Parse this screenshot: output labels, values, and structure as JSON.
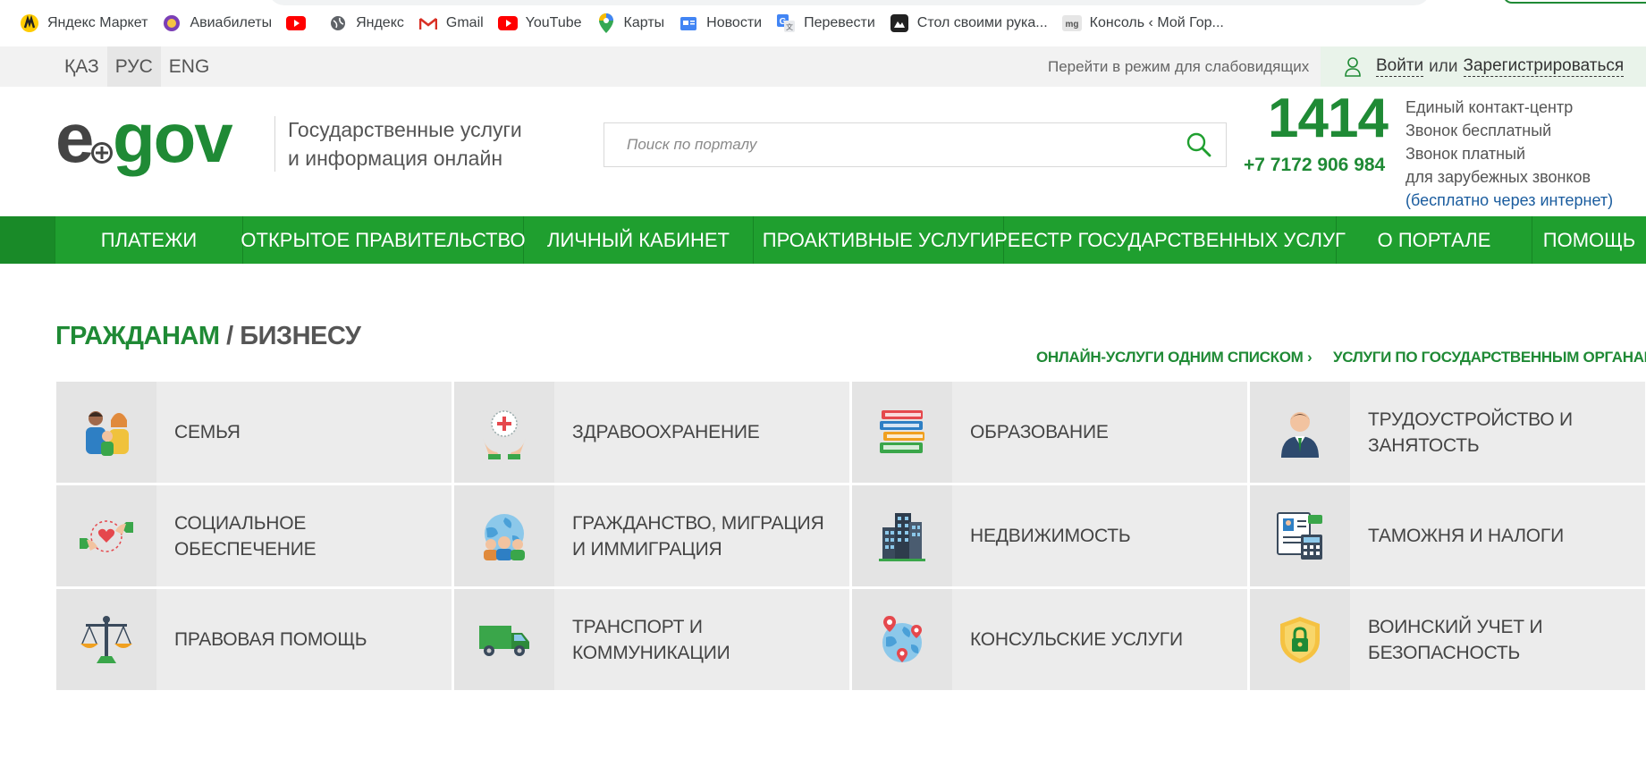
{
  "bookmarks": [
    {
      "label": "Яндекс Маркет",
      "icon": "yandex-market-icon"
    },
    {
      "label": "Авиабилеты",
      "icon": "aviatickets-icon"
    },
    {
      "label": "",
      "icon": "youtube-icon"
    },
    {
      "label": "Яндекс",
      "icon": "globe-icon"
    },
    {
      "label": "Gmail",
      "icon": "gmail-icon"
    },
    {
      "label": "YouTube",
      "icon": "youtube-icon"
    },
    {
      "label": "Карты",
      "icon": "maps-pin-icon"
    },
    {
      "label": "Новости",
      "icon": "news-icon"
    },
    {
      "label": "Перевести",
      "icon": "translate-icon"
    },
    {
      "label": "Стол своими рука...",
      "icon": "table-icon"
    },
    {
      "label": "Консоль ‹ Мой Гор...",
      "icon": "mg-icon"
    }
  ],
  "utility": {
    "languages": [
      "ҚАЗ",
      "РУС",
      "ENG"
    ],
    "active_language": "РУС",
    "vision_mode": "Перейти в режим для слабовидящих",
    "login": "Войти",
    "or": "или",
    "register": "Зарегистрироваться"
  },
  "header": {
    "logo_text": "egov",
    "tagline_line1": "Государственные услуги",
    "tagline_line2": "и информация онлайн",
    "search_placeholder": "Поиск по порталу",
    "phone_short": "1414",
    "phone_full": "+7 7172 906 984",
    "contact_line1": "Единый контакт-центр",
    "contact_line2": "Звонок бесплатный",
    "contact_line3": "Звонок платный",
    "contact_line4": "для зарубежных звонков",
    "contact_line5": "(бесплатно через интернет)"
  },
  "nav": [
    "ПЛАТЕЖИ",
    "ОТКРЫТОЕ ПРАВИТЕЛЬСТВО",
    "ЛИЧНЫЙ КАБИНЕТ",
    "ПРОАКТИВНЫЕ УСЛУГИ",
    "РЕЕСТР ГОСУДАРСТВЕННЫХ УСЛУГ",
    "О ПОРТАЛЕ",
    "ПОМОЩЬ"
  ],
  "main": {
    "title_citizens": "ГРАЖДАНАМ",
    "title_sep": " / ",
    "title_business": "БИЗНЕСУ",
    "link_online": "ОНЛАЙН-УСЛУГИ ОДНИМ СПИСКОМ ›",
    "link_by_agency": "УСЛУГИ ПО ГОСУДАРСТВЕННЫМ ОРГАНАМ ›",
    "categories": [
      {
        "label": "СЕМЬЯ",
        "icon": "family-icon"
      },
      {
        "label": "ЗДРАВООХРАНЕНИЕ",
        "icon": "healthcare-icon"
      },
      {
        "label": "ОБРАЗОВАНИЕ",
        "icon": "books-icon"
      },
      {
        "label": "ТРУДОУСТРОЙСТВО И ЗАНЯТОСТЬ",
        "icon": "employee-icon"
      },
      {
        "label": "СОЦИАЛЬНОЕ ОБЕСПЕЧЕНИЕ",
        "icon": "social-care-icon"
      },
      {
        "label": "ГРАЖДАНСТВО, МИГРАЦИЯ И ИММИГРАЦИЯ",
        "icon": "globe-people-icon"
      },
      {
        "label": "НЕДВИЖИМОСТЬ",
        "icon": "buildings-icon"
      },
      {
        "label": "ТАМОЖНЯ И НАЛОГИ",
        "icon": "tax-calculator-icon"
      },
      {
        "label": "ПРАВОВАЯ ПОМОЩЬ",
        "icon": "scales-icon"
      },
      {
        "label": "ТРАНСПОРТ И КОММУНИКАЦИИ",
        "icon": "truck-icon"
      },
      {
        "label": "КОНСУЛЬСКИЕ УСЛУГИ",
        "icon": "globe-pins-icon"
      },
      {
        "label": "ВОИНСКИЙ УЧЕТ И БЕЗОПАСНОСТЬ",
        "icon": "shield-lock-icon"
      }
    ]
  },
  "colors": {
    "brand_green": "#1f8a35",
    "nav_green": "#1f9f2f",
    "tile_bg": "#ececec"
  }
}
